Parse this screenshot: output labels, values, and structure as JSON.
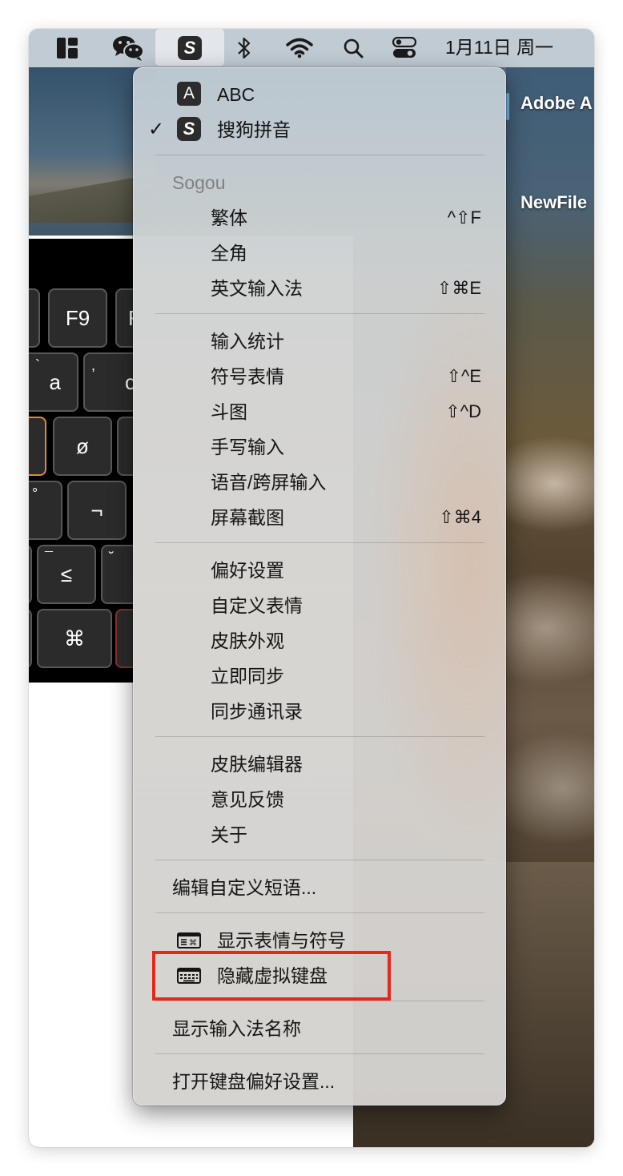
{
  "menubar": {
    "date": "1月11日 周一",
    "icons": [
      "dashboard-icon",
      "wechat-icon",
      "sogou-input-icon",
      "bluetooth-icon",
      "wifi-icon",
      "spotlight-search-icon",
      "control-center-icon"
    ]
  },
  "desktop": {
    "items": [
      "Adobe A",
      "NewFile"
    ]
  },
  "keyboard_viewer": {
    "keys": [
      {
        "main": "F9",
        "sub": ""
      },
      {
        "main": "F",
        "sub": ""
      },
      {
        "main": "a",
        "sub": "`"
      },
      {
        "main": "",
        "sub": ","
      },
      {
        "main": "c",
        "sub": ""
      },
      {
        "main": "ø",
        "sub": ""
      },
      {
        "main": "",
        "sub": "°"
      },
      {
        "main": "¬",
        "sub": ""
      },
      {
        "main": "≤",
        "sub": "¯"
      },
      {
        "main": "",
        "sub": "˘"
      },
      {
        "main": "⌘",
        "sub": ""
      }
    ]
  },
  "menu": {
    "input_sources": [
      {
        "label": "ABC",
        "icon_text": "A",
        "checked": false
      },
      {
        "label": "搜狗拼音",
        "icon_text": "S",
        "checked": true,
        "check_mark": "✓"
      }
    ],
    "section_header": "Sogou",
    "group1": [
      {
        "label": "繁体",
        "shortcut": "^⇧F"
      },
      {
        "label": "全角",
        "shortcut": ""
      },
      {
        "label": "英文输入法",
        "shortcut": "⇧⌘E"
      }
    ],
    "group2": [
      {
        "label": "输入统计",
        "shortcut": ""
      },
      {
        "label": "符号表情",
        "shortcut": "⇧^E"
      },
      {
        "label": "斗图",
        "shortcut": "⇧^D"
      },
      {
        "label": "手写输入",
        "shortcut": ""
      },
      {
        "label": "语音/跨屏输入",
        "shortcut": ""
      },
      {
        "label": "屏幕截图",
        "shortcut": "⇧⌘4"
      }
    ],
    "group3": [
      {
        "label": "偏好设置"
      },
      {
        "label": "自定义表情"
      },
      {
        "label": "皮肤外观"
      },
      {
        "label": "立即同步"
      },
      {
        "label": "同步通讯录"
      }
    ],
    "group4": [
      {
        "label": "皮肤编辑器"
      },
      {
        "label": "意见反馈"
      },
      {
        "label": "关于"
      }
    ],
    "edit_phrases": "编辑自定义短语...",
    "show_emoji": "显示表情与符号",
    "hide_keyboard": "隐藏虚拟键盘",
    "show_ime_name": "显示输入法名称",
    "open_keyboard_prefs": "打开键盘偏好设置...",
    "highlight_color": "#e8271b"
  }
}
